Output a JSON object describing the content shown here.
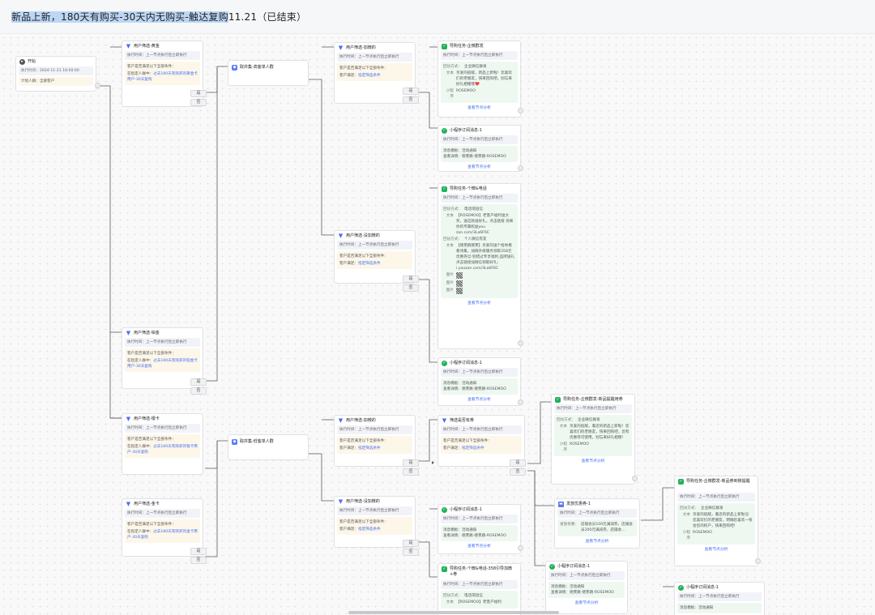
{
  "title": {
    "highlighted": "新品上新，180天有购买-30天内无购买-触达复购",
    "rest": "11.21（已结束）"
  },
  "labels": {
    "yes": "是",
    "no": "否",
    "exec_label": "执行时间：",
    "exec_prev": "上一节点执行后立即执行",
    "cond_title": "客户是否满足以下全部条件：",
    "customer_satisfy": "客户满足：",
    "satisfy_val": "指定筛选条件",
    "analysis": "查看节点分析",
    "send_method": "回访方式：",
    "text": "文本",
    "mini": "小程序",
    "image": "图片",
    "msg_template": "消息模板：",
    "msg_template_val": "活动通知",
    "view_detail": "查看详情：",
    "view_detail_val": "德芙跳-德芙跳-ROSEMOO",
    "mini_val": "ROSEMOO",
    "coupon_label": "发放优惠：",
    "enterprise": "企业微信群发",
    "sms": "电话或短信",
    "personal": "个人微信有友",
    "in_group": "在指定人群中："
  },
  "start": {
    "title": "开始",
    "time_label": "执行时间：",
    "time": "2024-11-21 16:00:00",
    "plan_label": "计划人群：",
    "plan": "全部客户"
  },
  "filters": {
    "gold": {
      "title": "用户筛选-黄金",
      "group": "过去180天有购买的黄金卡用户-30天复购"
    },
    "platinum": {
      "title": "用户筛选-铂金",
      "group": "过去180天有购买的铂金卡用户-30天复购"
    },
    "silver": {
      "title": "用户筛选-银卡",
      "group": "过去180天有购买的银卡用户-30天复购"
    },
    "goldcard": {
      "title": "用户筛选-金卡",
      "group": "过去180天有购买的金卡用户-30天复购"
    },
    "added1": {
      "title": "用户筛选-加微的"
    },
    "notadded1": {
      "title": "用户筛选-没加微的"
    },
    "added2": {
      "title": "用户筛选-加微的"
    },
    "notadded2": {
      "title": "用户筛选-没加微的"
    },
    "hascoupon": {
      "title": "筛选是否有券"
    }
  },
  "merges": {
    "high": "取并集-高客单人群",
    "low": "取并集-低客单人群"
  },
  "tasks": {
    "t1": {
      "title": "导购任务-企微群发",
      "text": "亲爱的宿敌，新品上新啦！您喜欢们的老朋友，快来回购吧，别忘来好礼相赠哦❤️"
    },
    "m1": {
      "title": "小程序订阅消息-1"
    },
    "t2": {
      "title": "导购任务-个微&电话",
      "text1": "【ROSEMOO】老客户福利送大奖，送这款送好礼，点击链接 领来你的专属权益you zan.com/3La6F6C",
      "text2": "【德芙跳德芙】亲爱的送个给你看看诗集，加微升级服务领取358元优惠券😊 别错过专享福利,品牌送礼 点击链接加微信领取好礼：i.youzan.com/3La6F6C"
    },
    "m2": {
      "title": "小程序订阅消息-1"
    },
    "t3": {
      "title": "导购任务-企微群发-新品提醒用券",
      "text": "亲爱的宿敌，着近的新品上新啦！您喜欢们的老朋友，快来回购吧，您有优惠券可使用，别忘来好礼相赠！"
    },
    "coupon": {
      "title": "发放优惠券-1",
      "value": "店铺会员100元满减券，店铺会员200元满减券，店铺会…"
    },
    "t4": {
      "title": "导购任务-企微群发-新品券到账提醒",
      "text": "亲爱的宿敌，着近的新品上新啦😊 您喜欢们的老朋友，明确您喜欢一张会您的权户，快来回购吧！"
    },
    "m3": {
      "title": "小程序订阅消息-1"
    },
    "m4": {
      "title": "小程序订阅消息-1"
    },
    "m5": {
      "title": "小程序订阅消息-1"
    },
    "t5": {
      "title": "导购任务-个微&电话-358引导加微+券",
      "text": "【ROSEMOO】老客户福利"
    }
  }
}
